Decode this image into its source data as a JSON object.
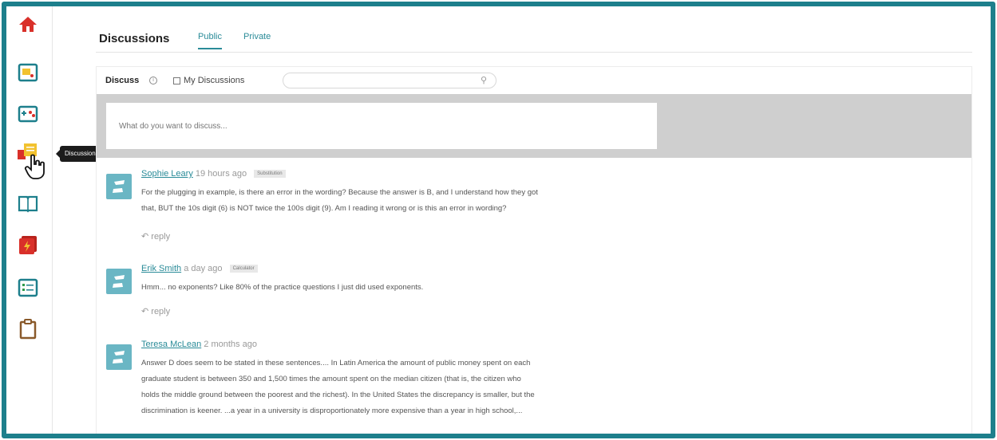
{
  "sidebar": {
    "tooltip": "Discussions",
    "icons": [
      "home-icon",
      "notes-icon",
      "practice-icon",
      "discussions-icon",
      "book-icon",
      "flashcards-icon",
      "checklist-icon",
      "clipboard-icon"
    ]
  },
  "header": {
    "title": "Discussions",
    "tabs": [
      {
        "label": "Public",
        "active": true
      },
      {
        "label": "Private",
        "active": false
      }
    ]
  },
  "discuss_bar": {
    "label": "Discuss",
    "my_discussions_label": "My Discussions",
    "search_placeholder": ""
  },
  "compose": {
    "placeholder": "What do you want to discuss..."
  },
  "posts": [
    {
      "author": "Sophie Leary",
      "time": "19 hours ago",
      "tag": "Substitution",
      "lines": [
        "For the plugging in example, is there an error in the wording? Because the answer is B, and I understand how they got",
        "that, BUT the 10s digit (6) is NOT twice the 100s digit (9). Am I reading it wrong or is this an error in wording?"
      ],
      "reply": "reply"
    },
    {
      "author": "Erik Smith",
      "time": "a day ago",
      "tag": "Calculator",
      "lines": [
        "Hmm... no exponents? Like 80% of the practice questions I just did used exponents."
      ],
      "reply": "reply"
    },
    {
      "author": "Teresa McLean",
      "time": "2 months ago",
      "tag": "",
      "lines": [
        "Answer D does seem to be stated in these sentences.... In Latin America the amount of public money spent on each",
        "graduate student is between 350 and 1,500 times the amount spent on the median citizen (that is, the citizen who",
        "holds the middle ground between the poorest and the richest). In the United States the discrepancy is smaller, but the",
        "discrimination is keener. ...a year in a university is disproportionately more expensive than a year in high school,..."
      ],
      "reply": ""
    }
  ],
  "colors": {
    "frame": "#1d7f8c",
    "accent": "#2a8b98",
    "avatar": "#6ab6c4",
    "compose_bg": "#cfcfcf"
  }
}
